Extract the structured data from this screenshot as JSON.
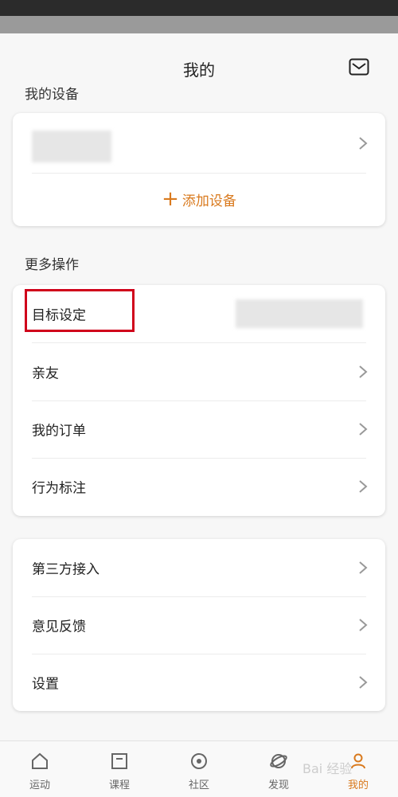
{
  "header": {
    "title": "我的",
    "mail_icon": "mail-icon"
  },
  "devices": {
    "section_title": "我的设备",
    "add_label": "添加设备",
    "accent": "#d97a1e"
  },
  "more": {
    "section_title": "更多操作",
    "items": [
      {
        "label": "目标设定"
      },
      {
        "label": "亲友"
      },
      {
        "label": "我的订单"
      },
      {
        "label": "行为标注"
      }
    ]
  },
  "other": {
    "items": [
      {
        "label": "第三方接入"
      },
      {
        "label": "意见反馈"
      },
      {
        "label": "设置"
      }
    ]
  },
  "tabbar": {
    "tabs": [
      {
        "label": "运动",
        "icon": "home-icon"
      },
      {
        "label": "课程",
        "icon": "course-icon"
      },
      {
        "label": "社区",
        "icon": "community-icon"
      },
      {
        "label": "发现",
        "icon": "discover-icon"
      },
      {
        "label": "我的",
        "icon": "profile-icon",
        "active": true
      }
    ]
  },
  "highlight_color": "#d0021b"
}
